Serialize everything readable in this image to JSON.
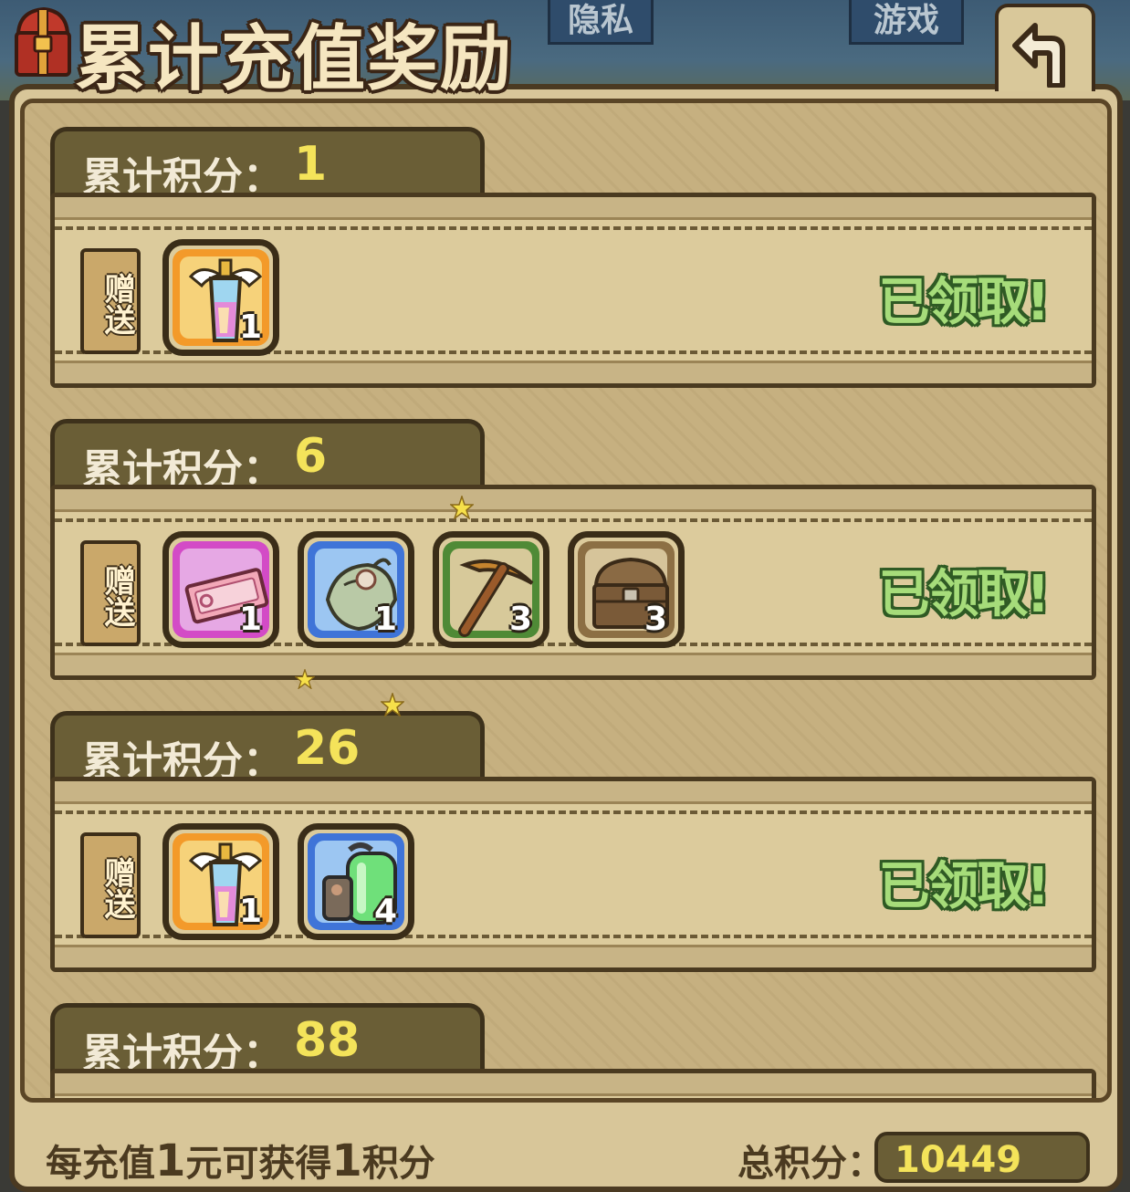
{
  "header": {
    "title": "累计充值奖励",
    "background_tabs": [
      "隐私",
      "游戏"
    ],
    "back_icon": "back-arrow-icon"
  },
  "tiers": [
    {
      "label": "累计积分：",
      "points": "1",
      "gift_label": "赠送",
      "status": "已领取!",
      "rewards": [
        {
          "icon": "winged-potion-icon",
          "count": "1",
          "frame": "orange"
        }
      ]
    },
    {
      "label": "累计积分：",
      "points": "6",
      "gift_label": "赠送",
      "status": "已领取!",
      "rewards": [
        {
          "icon": "ticket-icon",
          "count": "1",
          "frame": "pink"
        },
        {
          "icon": "seed-pod-icon",
          "count": "1",
          "frame": "blue"
        },
        {
          "icon": "pickaxe-icon",
          "count": "3",
          "frame": "green"
        },
        {
          "icon": "treasure-chest-icon",
          "count": "3",
          "frame": "tan"
        }
      ]
    },
    {
      "label": "累计积分：",
      "points": "26",
      "gift_label": "赠送",
      "status": "已领取!",
      "rewards": [
        {
          "icon": "winged-potion-icon",
          "count": "1",
          "frame": "orange"
        },
        {
          "icon": "green-canister-icon",
          "count": "4",
          "frame": "blue"
        }
      ]
    },
    {
      "label": "累计积分：",
      "points": "88"
    }
  ],
  "footer": {
    "note_parts": [
      "每充值",
      "1",
      "元可获得",
      "1",
      "积分"
    ],
    "total_label": "总积分：",
    "total_value": "10449"
  },
  "colors": {
    "points_yellow": "#f4e35a",
    "claimed_green": "#a6dc7a",
    "panel_tan": "#d8c699"
  }
}
